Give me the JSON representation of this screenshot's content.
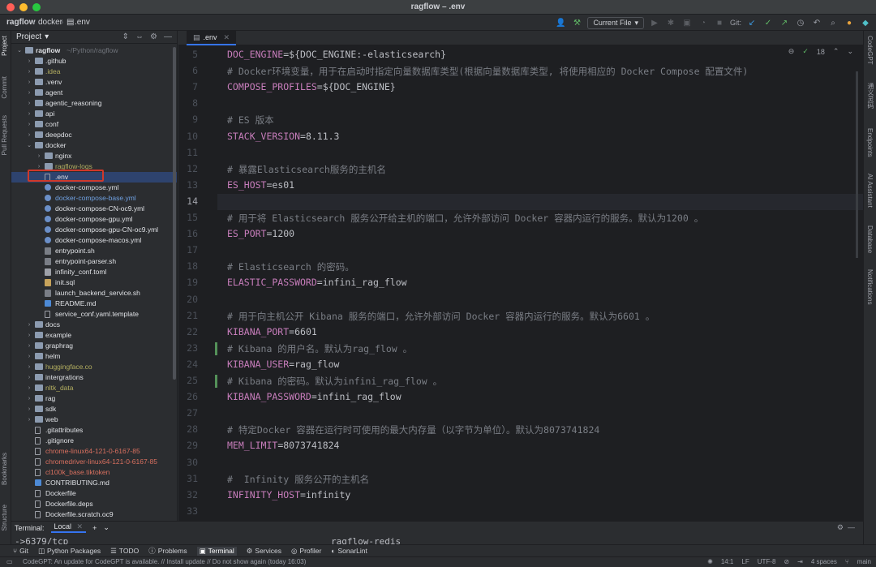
{
  "window": {
    "title": "ragflow – .env"
  },
  "breadcrumb": [
    "ragflow",
    "docker",
    ".env"
  ],
  "toolbar": {
    "run_config": "Current File",
    "git_label": "Git:"
  },
  "project_panel": {
    "title": "Project",
    "tree": [
      {
        "label": "ragflow",
        "suffix": "~/Python/ragflow",
        "type": "folder",
        "depth": 0,
        "expanded": true
      },
      {
        "label": ".github",
        "type": "folder",
        "depth": 1
      },
      {
        "label": ".idea",
        "type": "folder",
        "depth": 1,
        "color": "olive"
      },
      {
        "label": ".venv",
        "type": "folder",
        "depth": 1
      },
      {
        "label": "agent",
        "type": "folder",
        "depth": 1
      },
      {
        "label": "agentic_reasoning",
        "type": "folder",
        "depth": 1
      },
      {
        "label": "api",
        "type": "folder",
        "depth": 1
      },
      {
        "label": "conf",
        "type": "folder",
        "depth": 1
      },
      {
        "label": "deepdoc",
        "type": "folder",
        "depth": 1
      },
      {
        "label": "docker",
        "type": "folder",
        "depth": 1,
        "expanded": true
      },
      {
        "label": "nginx",
        "type": "folder",
        "depth": 2
      },
      {
        "label": "ragflow-logs",
        "type": "folder",
        "depth": 2,
        "color": "olive"
      },
      {
        "label": ".env",
        "type": "file",
        "depth": 2,
        "selected": true
      },
      {
        "label": "docker-compose.yml",
        "type": "yml",
        "depth": 2
      },
      {
        "label": "docker-compose-base.yml",
        "type": "yml",
        "depth": 2,
        "color": "blue"
      },
      {
        "label": "docker-compose-CN-oc9.yml",
        "type": "yml",
        "depth": 2
      },
      {
        "label": "docker-compose-gpu.yml",
        "type": "yml",
        "depth": 2
      },
      {
        "label": "docker-compose-gpu-CN-oc9.yml",
        "type": "yml",
        "depth": 2
      },
      {
        "label": "docker-compose-macos.yml",
        "type": "yml",
        "depth": 2
      },
      {
        "label": "entrypoint.sh",
        "type": "sh",
        "depth": 2
      },
      {
        "label": "entrypoint-parser.sh",
        "type": "sh",
        "depth": 2
      },
      {
        "label": "infinity_conf.toml",
        "type": "toml",
        "depth": 2
      },
      {
        "label": "init.sql",
        "type": "sql",
        "depth": 2
      },
      {
        "label": "launch_backend_service.sh",
        "type": "sh",
        "depth": 2
      },
      {
        "label": "README.md",
        "type": "md",
        "depth": 2
      },
      {
        "label": "service_conf.yaml.template",
        "type": "file",
        "depth": 2
      },
      {
        "label": "docs",
        "type": "folder",
        "depth": 1
      },
      {
        "label": "example",
        "type": "folder",
        "depth": 1
      },
      {
        "label": "graphrag",
        "type": "folder",
        "depth": 1
      },
      {
        "label": "helm",
        "type": "folder",
        "depth": 1
      },
      {
        "label": "huggingface.co",
        "type": "folder",
        "depth": 1,
        "color": "olive"
      },
      {
        "label": "intergrations",
        "type": "folder",
        "depth": 1
      },
      {
        "label": "nltk_data",
        "type": "folder",
        "depth": 1,
        "color": "olive"
      },
      {
        "label": "rag",
        "type": "folder",
        "depth": 1
      },
      {
        "label": "sdk",
        "type": "folder",
        "depth": 1
      },
      {
        "label": "web",
        "type": "folder",
        "depth": 1
      },
      {
        "label": ".gitattributes",
        "type": "file",
        "depth": 1
      },
      {
        "label": ".gitignore",
        "type": "file",
        "depth": 1
      },
      {
        "label": "chrome-linux64-121-0-6167-85",
        "type": "file",
        "depth": 1,
        "color": "red"
      },
      {
        "label": "chromedriver-linux64-121-0-6167-85",
        "type": "file",
        "depth": 1,
        "color": "red"
      },
      {
        "label": "cl100k_base.tiktoken",
        "type": "file",
        "depth": 1,
        "color": "red"
      },
      {
        "label": "CONTRIBUTING.md",
        "type": "md",
        "depth": 1
      },
      {
        "label": "Dockerfile",
        "type": "file",
        "depth": 1
      },
      {
        "label": "Dockerfile.deps",
        "type": "file",
        "depth": 1
      },
      {
        "label": "Dockerfile.scratch.oc9",
        "type": "file",
        "depth": 1
      }
    ]
  },
  "editor": {
    "tab_label": ".env",
    "inspection_count": "18",
    "current_line": 14,
    "lines": [
      {
        "n": "5",
        "key": "DOC_ENGINE",
        "val": "=${DOC_ENGINE:-elasticsearch}"
      },
      {
        "n": "6",
        "comment": "# Docker环境变量，用于在启动时指定向量数据库类型(根据向量数据库类型, 将使用相应的 Docker Compose 配置文件)"
      },
      {
        "n": "7",
        "key": "COMPOSE_PROFILES",
        "val": "=${DOC_ENGINE}"
      },
      {
        "n": "8"
      },
      {
        "n": "9",
        "comment": "# ES 版本"
      },
      {
        "n": "10",
        "key": "STACK_VERSION",
        "val": "=8.11.3"
      },
      {
        "n": "11"
      },
      {
        "n": "12",
        "comment": "# 暴露Elasticsearch服务的主机名"
      },
      {
        "n": "13",
        "key": "ES_HOST",
        "val": "=es01"
      },
      {
        "n": "14"
      },
      {
        "n": "15",
        "comment": "# 用于将 Elasticsearch 服务公开给主机的端口，允许外部访问 Docker 容器内运行的服务。默认为1200 。"
      },
      {
        "n": "16",
        "key": "ES_PORT",
        "val": "=1200"
      },
      {
        "n": "17"
      },
      {
        "n": "18",
        "comment": "# Elasticsearch 的密码。"
      },
      {
        "n": "19",
        "key": "ELASTIC_PASSWORD",
        "val": "=infini_rag_flow"
      },
      {
        "n": "20"
      },
      {
        "n": "21",
        "comment": "# 用于向主机公开 Kibana 服务的端口，允许外部访问 Docker 容器内运行的服务。默认为6601 。"
      },
      {
        "n": "22",
        "key": "KIBANA_PORT",
        "val": "=6601"
      },
      {
        "n": "23",
        "comment": "# Kibana 的用户名。默认为rag_flow 。"
      },
      {
        "n": "24",
        "key": "KIBANA_USER",
        "val": "=rag_flow"
      },
      {
        "n": "25",
        "comment": "# Kibana 的密码。默认为infini_rag_flow 。"
      },
      {
        "n": "26",
        "key": "KIBANA_PASSWORD",
        "val": "=infini_rag_flow"
      },
      {
        "n": "27"
      },
      {
        "n": "28",
        "comment": "# 特定Docker 容器在运行时可使用的最大内存量（以字节为单位）。默认为8073741824"
      },
      {
        "n": "29",
        "key": "MEM_LIMIT",
        "val": "=8073741824"
      },
      {
        "n": "30"
      },
      {
        "n": "31",
        "comment": "#  Infinity 服务公开的主机名"
      },
      {
        "n": "32",
        "key": "INFINITY_HOST",
        "val": "=infinity"
      },
      {
        "n": "33"
      }
    ]
  },
  "terminal": {
    "label": "Terminal:",
    "tab": "Local",
    "line_left": "->6379/tcp",
    "line_right": "ragflow-redis"
  },
  "tool_windows": [
    {
      "label": "Git",
      "icon": "git-icon"
    },
    {
      "label": "Python Packages",
      "icon": "packages-icon"
    },
    {
      "label": "TODO",
      "icon": "todo-icon"
    },
    {
      "label": "Problems",
      "icon": "problems-icon"
    },
    {
      "label": "Terminal",
      "icon": "terminal-icon",
      "active": true
    },
    {
      "label": "Services",
      "icon": "services-icon"
    },
    {
      "label": "Profiler",
      "icon": "profiler-icon"
    },
    {
      "label": "SonarLint",
      "icon": "sonarlint-icon"
    }
  ],
  "status": {
    "message": "CodeGPT: An update for CodeGPT is available. // Install update // Do not show again (today 16:03)",
    "position": "14:1",
    "line_sep": "LF",
    "encoding": "UTF-8",
    "indent": "4 spaces",
    "branch": "main"
  },
  "left_stripe": [
    "Project",
    "Commit",
    "Pull Requests",
    "Bookmarks",
    "Structure"
  ],
  "right_stripe": [
    "CodeGPT",
    "通义灵码",
    "Endpoints",
    "AI Assistant",
    "Database",
    "Notifications"
  ]
}
